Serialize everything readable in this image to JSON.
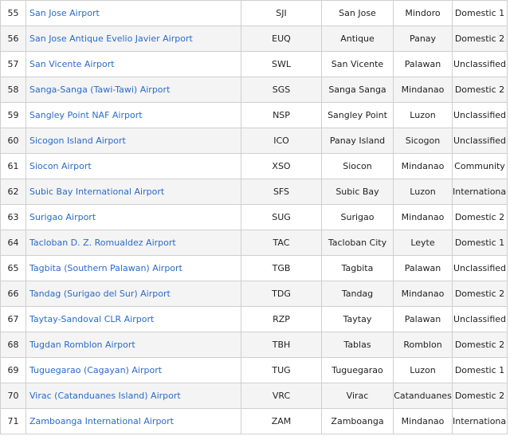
{
  "rows": [
    {
      "num": "55",
      "name": "San Jose Airport",
      "code": "SJI",
      "city": "San Jose",
      "island": "Mindoro",
      "classification": "Domestic 1"
    },
    {
      "num": "56",
      "name": "San Jose Antique Evelio Javier Airport",
      "code": "EUQ",
      "city": "Antique",
      "island": "Panay",
      "classification": "Domestic 2"
    },
    {
      "num": "57",
      "name": "San Vicente Airport",
      "code": "SWL",
      "city": "San Vicente",
      "island": "Palawan",
      "classification": "Unclassified"
    },
    {
      "num": "58",
      "name": "Sanga-Sanga (Tawi-Tawi) Airport",
      "code": "SGS",
      "city": "Sanga Sanga",
      "island": "Mindanao",
      "classification": "Domestic 2"
    },
    {
      "num": "59",
      "name": "Sangley Point NAF Airport",
      "code": "NSP",
      "city": "Sangley Point",
      "island": "Luzon",
      "classification": "Unclassified"
    },
    {
      "num": "60",
      "name": "Sicogon Island Airport",
      "code": "ICO",
      "city": "Panay Island",
      "island": "Sicogon",
      "classification": "Unclassified"
    },
    {
      "num": "61",
      "name": "Siocon Airport",
      "code": "XSO",
      "city": "Siocon",
      "island": "Mindanao",
      "classification": "Community"
    },
    {
      "num": "62",
      "name": "Subic Bay International Airport",
      "code": "SFS",
      "city": "Subic Bay",
      "island": "Luzon",
      "classification": "International"
    },
    {
      "num": "63",
      "name": "Surigao Airport",
      "code": "SUG",
      "city": "Surigao",
      "island": "Mindanao",
      "classification": "Domestic 2"
    },
    {
      "num": "64",
      "name": "Tacloban D. Z. Romualdez Airport",
      "code": "TAC",
      "city": "Tacloban City",
      "island": "Leyte",
      "classification": "Domestic 1"
    },
    {
      "num": "65",
      "name": "Tagbita (Southern Palawan) Airport",
      "code": "TGB",
      "city": "Tagbita",
      "island": "Palawan",
      "classification": "Unclassified"
    },
    {
      "num": "66",
      "name": "Tandag (Surigao del Sur) Airport",
      "code": "TDG",
      "city": "Tandag",
      "island": "Mindanao",
      "classification": "Domestic 2"
    },
    {
      "num": "67",
      "name": "Taytay-Sandoval CLR Airport",
      "code": "RZP",
      "city": "Taytay",
      "island": "Palawan",
      "classification": "Unclassified"
    },
    {
      "num": "68",
      "name": "Tugdan Romblon Airport",
      "code": "TBH",
      "city": "Tablas",
      "island": "Romblon",
      "classification": "Domestic 2"
    },
    {
      "num": "69",
      "name": "Tuguegarao (Cagayan) Airport",
      "code": "TUG",
      "city": "Tuguegarao",
      "island": "Luzon",
      "classification": "Domestic 1"
    },
    {
      "num": "70",
      "name": "Virac (Catanduanes Island) Airport",
      "code": "VRC",
      "city": "Virac",
      "island": "Catanduanes",
      "classification": "Domestic 2"
    },
    {
      "num": "71",
      "name": "Zamboanga International Airport",
      "code": "ZAM",
      "city": "Zamboanga",
      "island": "Mindanao",
      "classification": "International"
    }
  ]
}
